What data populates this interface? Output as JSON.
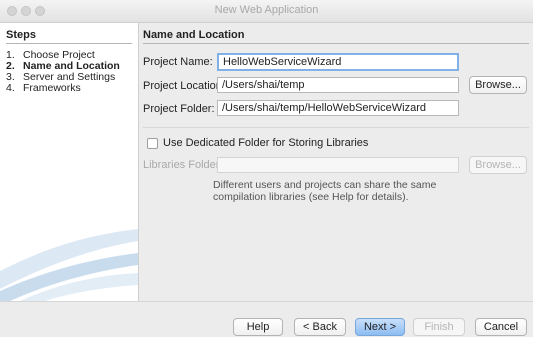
{
  "window": {
    "title": "New Web Application"
  },
  "steps": {
    "heading": "Steps",
    "items": [
      {
        "number": "1.",
        "label": "Choose Project"
      },
      {
        "number": "2.",
        "label": "Name and Location"
      },
      {
        "number": "3.",
        "label": "Server and Settings"
      },
      {
        "number": "4.",
        "label": "Frameworks"
      }
    ],
    "current_index": 1
  },
  "panel": {
    "heading": "Name and Location",
    "project_name": {
      "label": "Project Name:",
      "value": "HelloWebServiceWizard"
    },
    "project_location": {
      "label": "Project Location:",
      "value": "/Users/shai/temp",
      "browse_label": "Browse..."
    },
    "project_folder": {
      "label": "Project Folder:",
      "value": "/Users/shai/temp/HelloWebServiceWizard"
    },
    "dedicated_folder": {
      "label": "Use Dedicated Folder for Storing Libraries",
      "checked": false
    },
    "libraries_folder": {
      "label": "Libraries Folder:",
      "value": "",
      "browse_label": "Browse..."
    },
    "info_lines": [
      "Different users and projects can share the same",
      "compilation libraries (see Help for details)."
    ]
  },
  "footer": {
    "help_label": "Help",
    "back_label": "< Back",
    "next_label": "Next >",
    "finish_label": "Finish",
    "cancel_label": "Cancel"
  },
  "colors": {
    "default_button": "#8dbcf2",
    "focus_ring": "#7fb0e6"
  }
}
